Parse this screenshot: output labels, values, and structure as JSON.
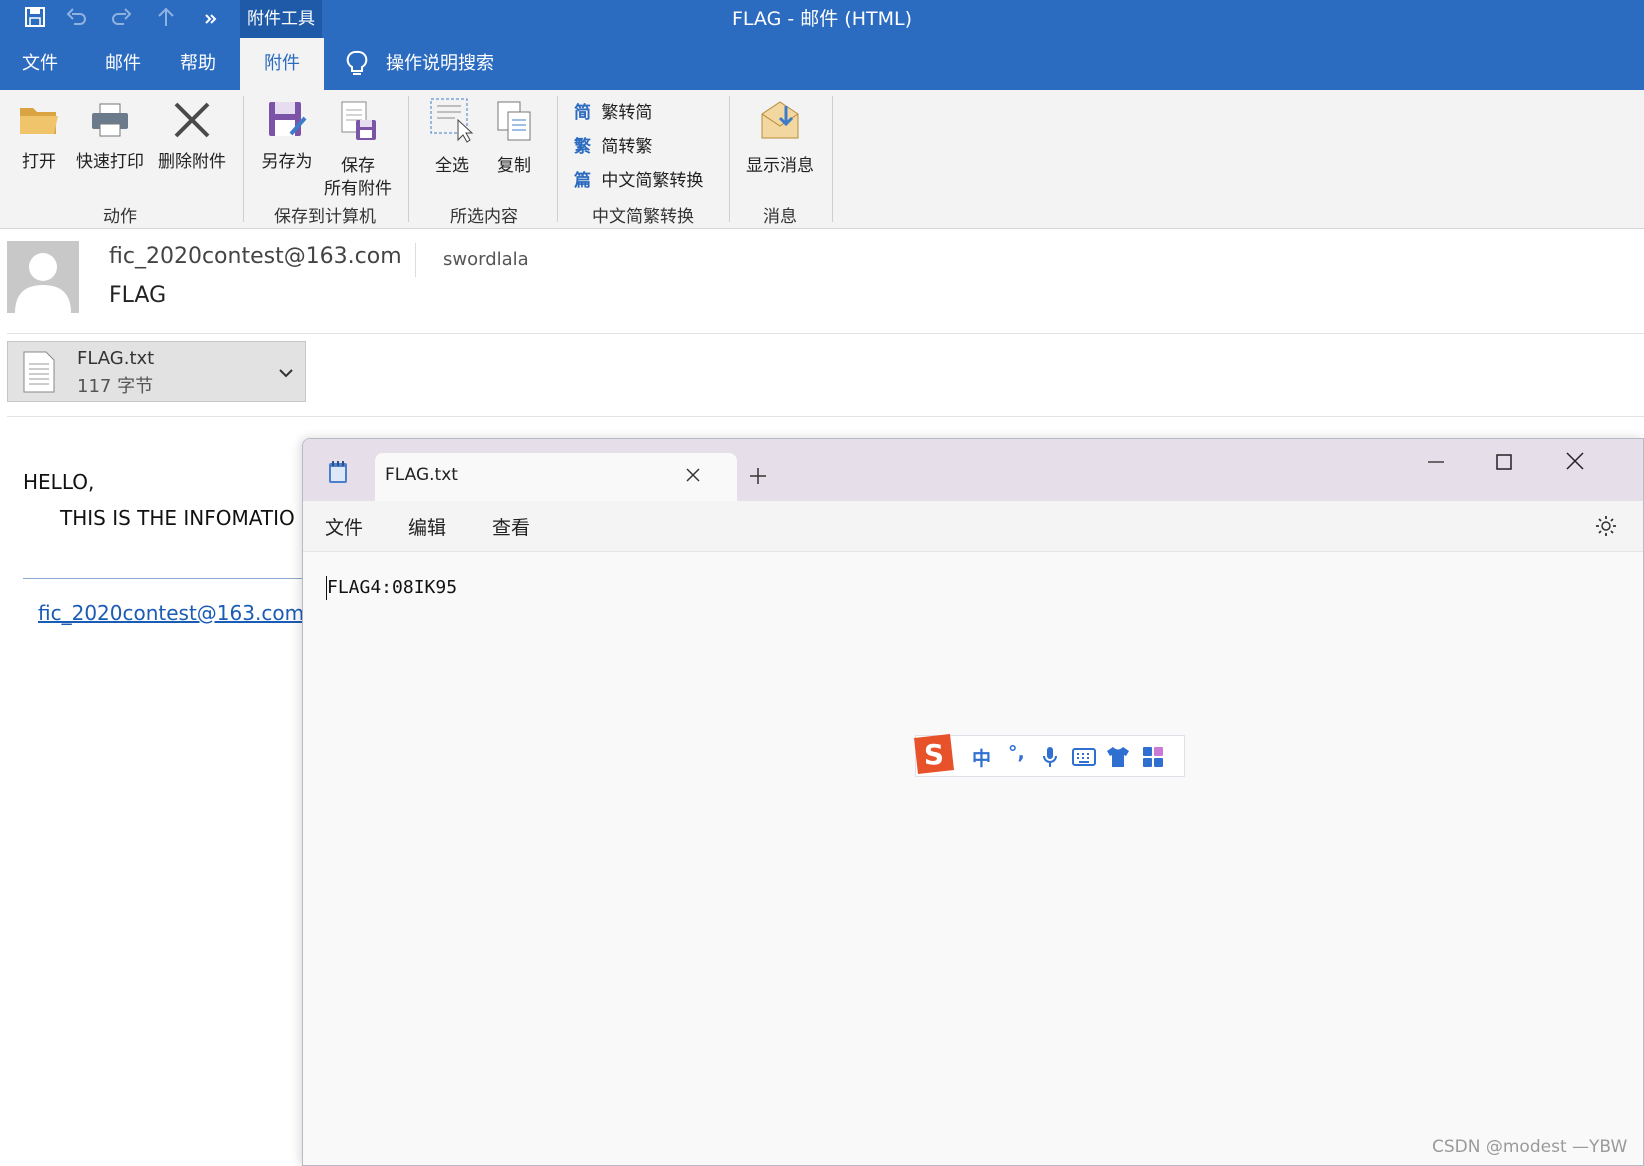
{
  "titlebar": {
    "context_tab": "附件工具",
    "window_title": "FLAG  -  邮件 (HTML)"
  },
  "ribbon_tabs": [
    "文件",
    "邮件",
    "帮助",
    "附件"
  ],
  "search_label": "操作说明搜索",
  "ribbon": {
    "actions": {
      "open": "打开",
      "quick_print": "快速打印",
      "remove": "删除附件",
      "group": "动作"
    },
    "save": {
      "save_as": "另存为",
      "save_all_1": "保存",
      "save_all_2": "所有附件",
      "group": "保存到计算机"
    },
    "selection": {
      "select_all": "全选",
      "copy": "复制",
      "group": "所选内容"
    },
    "convert": {
      "to_simplified": "繁转简",
      "to_simplified_glyph": "简",
      "to_traditional": "简转繁",
      "to_traditional_glyph": "繁",
      "convert": "中文简繁转换",
      "convert_glyph": "篇",
      "group": "中文简繁转换"
    },
    "message": {
      "show": "显示消息",
      "group": "消息"
    }
  },
  "mail": {
    "from": "fic_2020contest@163.com",
    "to": "swordlala",
    "subject": "FLAG",
    "attachment": {
      "name": "FLAG.txt",
      "size": "117 字节"
    },
    "greeting": "HELLO,",
    "body": "THIS IS THE INFOMATIO",
    "link": "fic_2020contest@163.com"
  },
  "notepad": {
    "tab_title": "FLAG.txt",
    "menu": [
      "文件",
      "编辑",
      "查看"
    ],
    "content": "FLAG4:08IK95"
  },
  "ime": {
    "mode": "中",
    "punct": "°,"
  },
  "watermark": "CSDN @modest —YBW",
  "colors": {
    "accent": "#2b6bc0",
    "notepad_titlebar": "#e6dfea",
    "sogou": "#e8522b"
  }
}
